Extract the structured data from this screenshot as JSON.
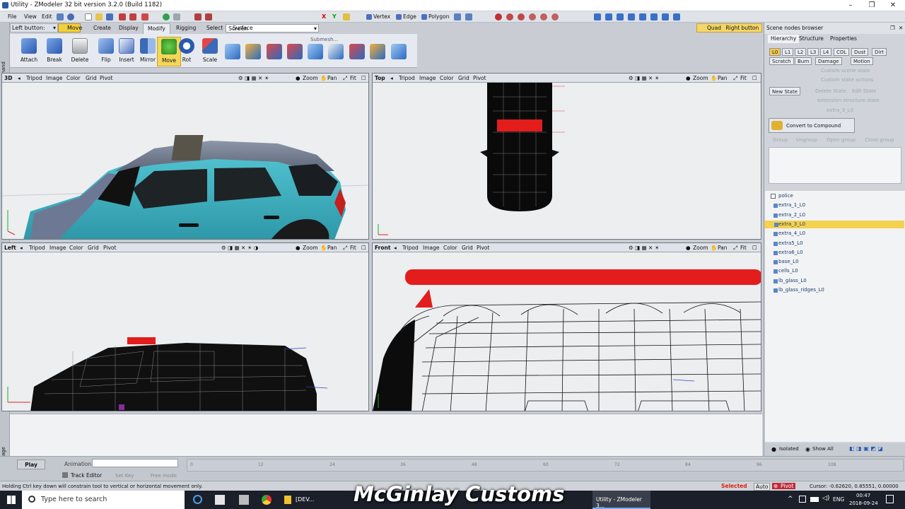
{
  "window": {
    "title": "Utility - ZModeler 32 bit version 3.2.0 (Build 1182)"
  },
  "menu": {
    "items": [
      "File",
      "View",
      "Edit"
    ],
    "screen_combo": "Screen",
    "modes": [
      "Vertex",
      "Edge",
      "Polygon"
    ]
  },
  "toolbar2": {
    "left_button_label": "Left button:",
    "move_badge": "Move",
    "tabs": [
      "Create",
      "Display",
      "Modify",
      "Rigging",
      "Select",
      "Surface"
    ],
    "active_tab": "Modify",
    "quad_label": "Quad",
    "right_button_label": "Right button"
  },
  "ribbon": {
    "buttons": [
      {
        "label": "Attach",
        "icon": "attach-icon"
      },
      {
        "label": "Break",
        "icon": "break-icon"
      },
      {
        "label": "Delete",
        "icon": "delete-icon"
      },
      {
        "label": "Flip",
        "icon": "flip-icon"
      },
      {
        "label": "Insert",
        "icon": "insert-icon"
      },
      {
        "label": "Mirror",
        "icon": "mirror-icon"
      },
      {
        "label": "Move",
        "icon": "move-icon"
      },
      {
        "label": "Rot",
        "icon": "rotate-icon"
      },
      {
        "label": "Scale",
        "icon": "scale-icon"
      }
    ],
    "submesh_label": "Submesh..."
  },
  "viewports": [
    {
      "name": "3D",
      "menu": [
        "Tripod",
        "Image",
        "Color",
        "Grid",
        "Pivot"
      ],
      "nav": [
        "Zoom",
        "Pan",
        "Fit"
      ]
    },
    {
      "name": "Top",
      "menu": [
        "Tripod",
        "Image",
        "Color",
        "Grid",
        "Pivot"
      ],
      "nav": [
        "Zoom",
        "Pan",
        "Fit"
      ]
    },
    {
      "name": "Left",
      "menu": [
        "Tripod",
        "Image",
        "Color",
        "Grid",
        "Pivot"
      ],
      "nav": [
        "Zoom",
        "Pan",
        "Fit"
      ]
    },
    {
      "name": "Front",
      "menu": [
        "Tripod",
        "Image",
        "Color",
        "Grid",
        "Pivot"
      ],
      "nav": [
        "Zoom",
        "Pan",
        "Fit"
      ]
    }
  ],
  "side_panel": {
    "title": "Scene nodes browser",
    "tabs": [
      "Hierarchy",
      "Structure",
      "Properties"
    ],
    "lod_tags": [
      "L0",
      "L1",
      "L2",
      "L3",
      "L4",
      "COL",
      "Dust",
      "Dirt"
    ],
    "state_tags": [
      "Scratch",
      "Burn",
      "Damage",
      "Motion"
    ],
    "faded_rows": [
      "Custom scene state",
      "Custom state actions",
      "extension structure state",
      "extra_3_L0"
    ],
    "new_state": "New State",
    "delete_state": "Delete State",
    "edit_state": "Edit State",
    "convert_button": "Convert to Compound",
    "faded_actions": [
      "Group",
      "Ungroup",
      "Open group",
      "Close group"
    ],
    "tree": [
      {
        "label": "police",
        "selected": false,
        "root": true
      },
      {
        "label": "extra_1_L0",
        "selected": false
      },
      {
        "label": "extra_2_L0",
        "selected": false
      },
      {
        "label": "extra_3_L0",
        "selected": true
      },
      {
        "label": "extra_4_L0",
        "selected": false
      },
      {
        "label": "extra5_L0",
        "selected": false
      },
      {
        "label": "extra6_L0",
        "selected": false
      },
      {
        "label": "base_L0",
        "selected": false
      },
      {
        "label": "cells_L0",
        "selected": false
      },
      {
        "label": "lb_glass_L0",
        "selected": false
      },
      {
        "label": "lb_glass_ridges_L0",
        "selected": false
      }
    ],
    "footer": {
      "isolated": "Isolated",
      "show_all": "Show All"
    }
  },
  "side_labels": {
    "command": "Command",
    "message": "Message"
  },
  "animation": {
    "play": "Play",
    "label": "Animation:",
    "track_editor": "Track Editor",
    "set_key": "Set Key",
    "free_mode": "Free mode",
    "ticks": [
      "0",
      "12",
      "24",
      "36",
      "48",
      "60",
      "72",
      "84",
      "96",
      "108"
    ]
  },
  "status": {
    "hint": "Holding Ctrl key down will constrain tool to vertical or horizontal movement only.",
    "selected": "Selected",
    "auto": "Auto",
    "pivot": "Pivot",
    "cursor": "Cursor: -0.62620, 0.85551, 0.00000"
  },
  "taskbar": {
    "search_placeholder": "Type here to search",
    "dev_label": "[DEV...",
    "zmodeler_label": "Utility - ZModeler 3...",
    "lang": "ENG",
    "time": "00:47",
    "date": "2018-09-24"
  },
  "watermark": "McGinlay Customs",
  "colors": {
    "selection": "#f4d14e",
    "accent_red": "#e01010",
    "car_teal": "#3bb3c2",
    "viewport_bg": "#e9ebed"
  }
}
